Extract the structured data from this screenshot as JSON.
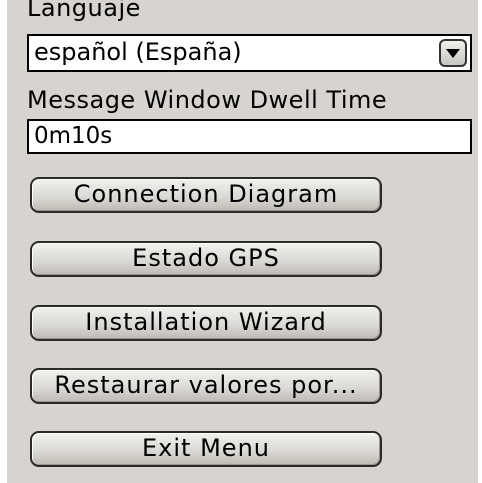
{
  "language": {
    "label": "Languaje",
    "selected": "español (España)",
    "dropdown_icon": "chevron-down-icon"
  },
  "dwell": {
    "label": "Message Window Dwell Time",
    "value": "0m10s"
  },
  "buttons": {
    "connection_diagram": "Connection Diagram",
    "gps_status": "Estado GPS",
    "installation_wizard": "Installation Wizard",
    "restore_defaults": "Restaurar valores por...",
    "exit_menu": "Exit Menu"
  },
  "colors": {
    "panel_bg": "#d7d4cf",
    "field_bg": "#ffffff",
    "border": "#000000"
  }
}
